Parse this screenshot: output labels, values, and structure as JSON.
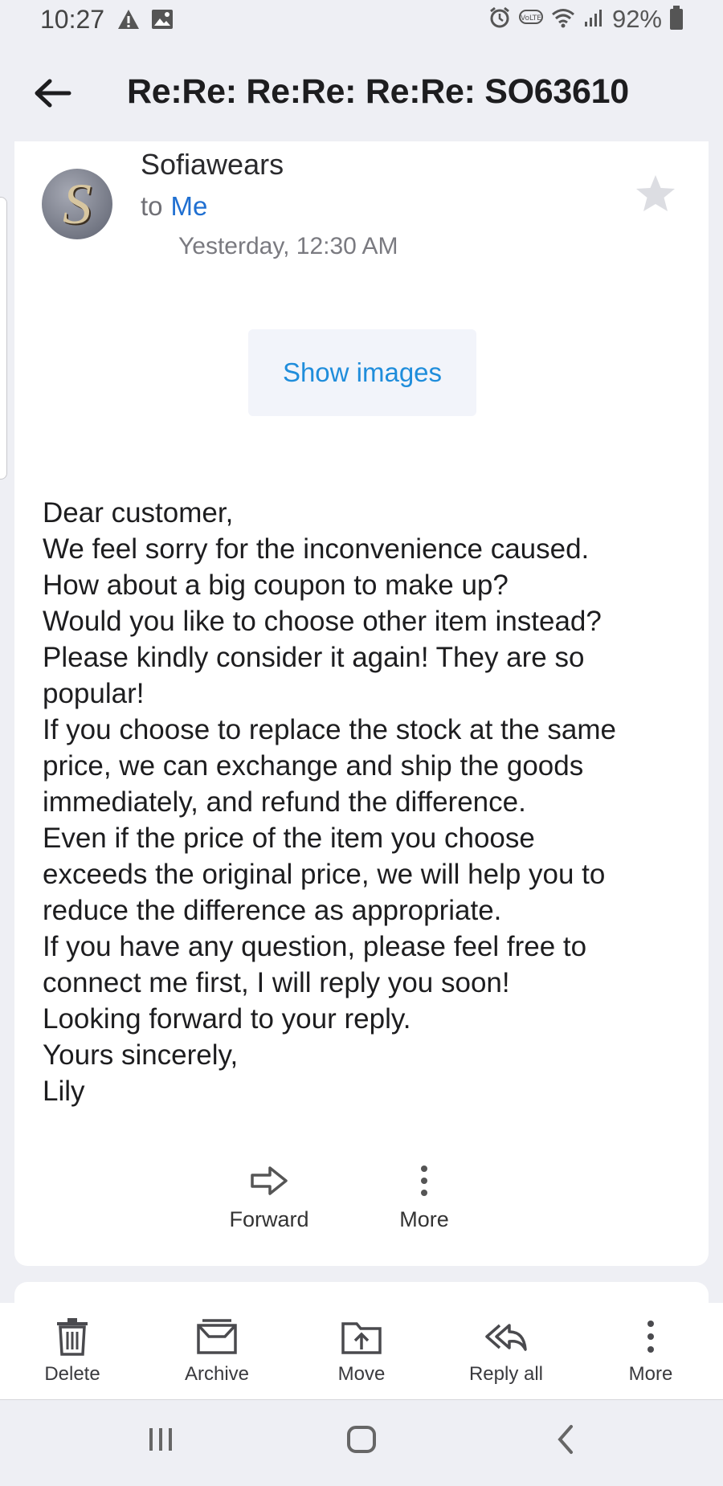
{
  "status_bar": {
    "time": "10:27",
    "battery": "92%"
  },
  "header": {
    "subject": "Re:Re: Re:Re: Re:Re: SO63610"
  },
  "email": {
    "sender": "Sofiawears",
    "avatar_letter": "S",
    "to_prefix": "to",
    "to_name": "Me",
    "date": "Yesterday, 12:30 AM",
    "show_images_label": "Show images",
    "body_lines": [
      "Dear customer,",
      "We feel sorry for the inconvenience caused.",
      "How about a big coupon to make up?",
      "Would you like to choose other item instead?",
      "Please kindly consider it again! They are so\npopular!",
      "If you choose to replace the stock at the same\nprice, we can exchange and ship the goods\nimmediately, and refund the difference.",
      "Even if the price of the item you choose\nexceeds the original price, we will help you to\nreduce the difference as appropriate.",
      "If you have any question, please feel free to\nconnect me first, I will reply you soon!",
      "Looking forward to your reply.",
      "Yours sincerely,",
      "Lily"
    ],
    "actions": {
      "forward": "Forward",
      "more": "More"
    }
  },
  "toolbar": {
    "delete": "Delete",
    "archive": "Archive",
    "move": "Move",
    "reply_all": "Reply all",
    "more": "More"
  },
  "colors": {
    "accent_blue": "#1f6fd1",
    "link_blue": "#1f8ddb",
    "background": "#eeeff4"
  }
}
